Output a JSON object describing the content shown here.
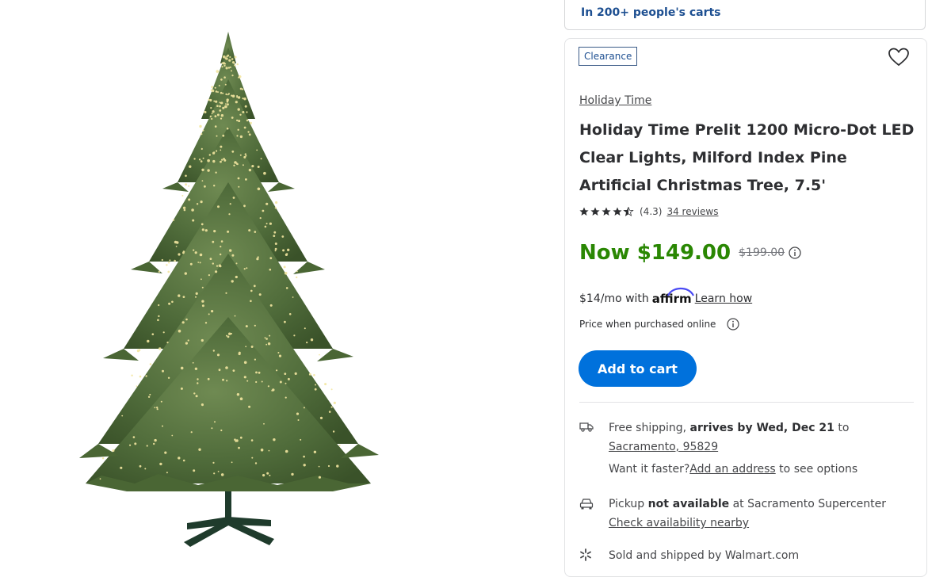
{
  "banner": {
    "popular_text": "In 200+ people's carts"
  },
  "product": {
    "badge": "Clearance",
    "brand": "Holiday Time",
    "title": "Holiday Time Prelit 1200 Micro-Dot LED Clear Lights, Milford Index Pine Artificial Christmas Tree, 7.5'",
    "rating_value": 4.3,
    "rating_text": "(4.3)",
    "reviews_link": "34 reviews",
    "now_price": "Now $149.00",
    "was_price": "$199.00",
    "affirm_prefix": "$14/mo with",
    "affirm_logo": "affirm",
    "learn_link": "Learn how",
    "price_note": "Price when purchased online",
    "add_to_cart": "Add to cart",
    "price_color": "#2a8703",
    "button_color": "#0071dc"
  },
  "fulfillment": {
    "shipping": {
      "icon": "truck-icon",
      "text_prefix": "Free shipping, ",
      "arrival": "arrives by Wed, Dec 21",
      "text_to": " to",
      "location_link": "Sacramento, 95829",
      "faster_prefix": "Want it faster? ",
      "faster_link": "Add an address",
      "faster_suffix": " to see options"
    },
    "pickup": {
      "icon": "car-icon",
      "prefix": "Pickup ",
      "status": "not available",
      "suffix": " at Sacramento Supercenter",
      "check_link": "Check availability nearby"
    },
    "seller": {
      "icon": "spark-icon",
      "text": "Sold and shipped by Walmart.com"
    }
  }
}
